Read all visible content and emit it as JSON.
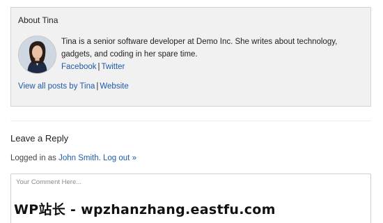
{
  "author_box": {
    "title": "About Tina",
    "bio": "Tina is a senior software developer at Demo Inc. She writes about technology, gadgets, and coding in her spare time.",
    "links": {
      "facebook": "Facebook",
      "separator": "|",
      "twitter": "Twitter"
    },
    "footer_links": {
      "all_posts": "View all posts by Tina",
      "separator": "|",
      "website": "Website"
    },
    "avatar_icon": "user-avatar-photo"
  },
  "reply": {
    "title": "Leave a Reply",
    "logged_in_prefix": "Logged in as ",
    "user_name": "John Smith",
    "user_suffix": ".",
    "logout": "Log out »",
    "comment_placeholder": "Your Comment Here...",
    "comment_value": ""
  },
  "watermark": {
    "text": "WP站长 - wpzhanzhang.eastfu.com"
  },
  "colors": {
    "link": "#1e5aa8",
    "box_bg": "#f1f1f1",
    "box_border": "#d4d4d4"
  }
}
